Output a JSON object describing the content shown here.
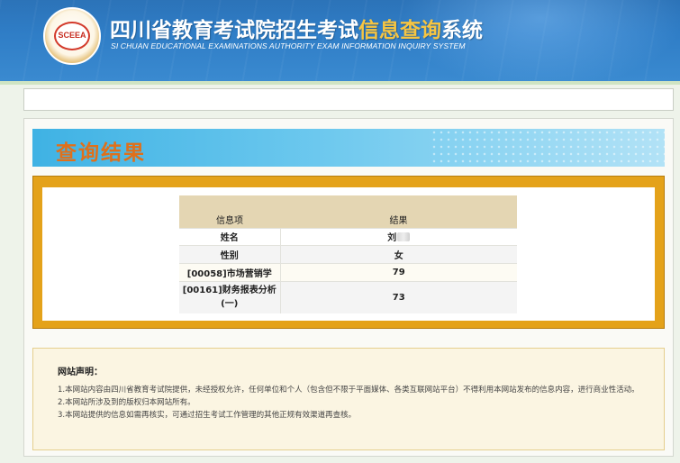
{
  "header": {
    "title_prefix": "四川省教育考试院招生考试",
    "title_highlight": "信息查询",
    "title_suffix": "系统",
    "subtitle": "SI CHUAN EDUCATIONAL EXAMINATIONS AUTHORITY EXAM INFORMATION INQUIRY SYSTEM",
    "logo_text": "SCEEA"
  },
  "result": {
    "heading": "查询结果",
    "columns": [
      "信息项",
      "结果"
    ],
    "rows": [
      {
        "item": "姓名",
        "value": "刘"
      },
      {
        "item": "性别",
        "value": "女"
      },
      {
        "item": "[00058]市场营销学",
        "value": "79"
      },
      {
        "item": "[00161]财务报表分析(一)",
        "value": "73"
      }
    ]
  },
  "notice": {
    "title": "网站声明：",
    "lines": [
      "1.本网站内容由四川省教育考试院提供，未经授权允许，任何单位和个人（包含但不限于平面媒体、各类互联网站平台）不得利用本网站发布的信息内容，进行商业性活动。",
      "2.本网站所涉及到的版权归本网站所有。",
      "3.本网站提供的信息如需再核实，可通过招生考试工作管理的其他正规有效渠道再查核。"
    ]
  },
  "colors": {
    "header_blue": "#2f7dc6",
    "title_highlight": "#f6c542",
    "result_heading": "#e0701a",
    "gold_frame": "#e4a21a",
    "table_header": "#e4d6b3"
  }
}
